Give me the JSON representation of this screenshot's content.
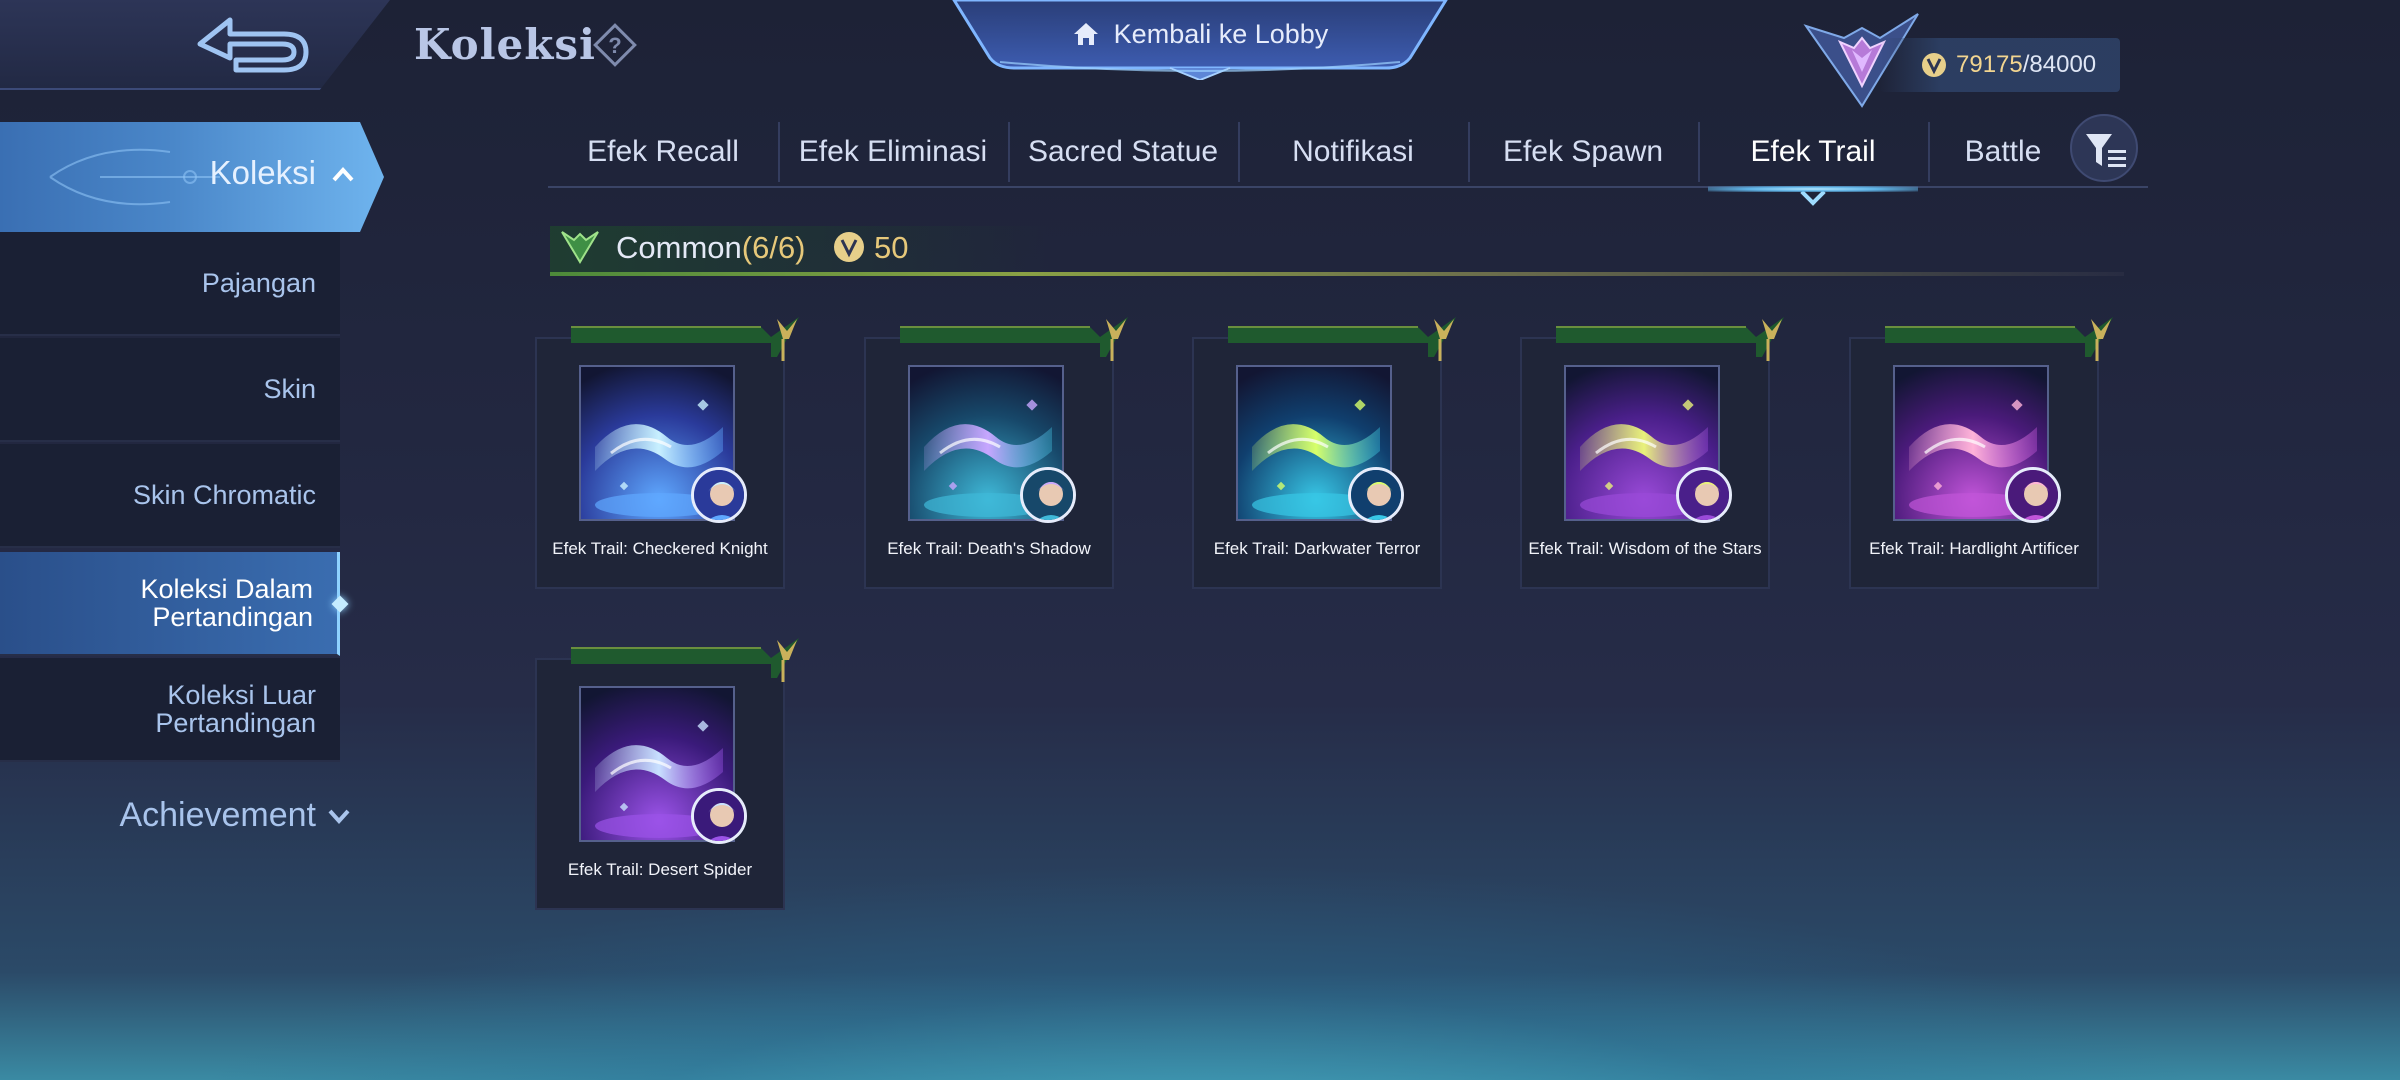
{
  "header": {
    "title": "Koleksi",
    "lobby_label": "Kembali ke Lobby",
    "currency_current": "79175",
    "currency_total": "/84000"
  },
  "sidebar": {
    "main_label": "Koleksi",
    "items": [
      {
        "label": "Pajangan",
        "active": false
      },
      {
        "label": "Skin",
        "active": false
      },
      {
        "label": "Skin Chromatic",
        "active": false
      },
      {
        "label": "Koleksi Dalam Pertandingan",
        "active": true
      },
      {
        "label": "Koleksi Luar Pertandingan",
        "active": false
      }
    ],
    "achievement_label": "Achievement"
  },
  "tabs": [
    {
      "label": "Efek Recall",
      "active": false
    },
    {
      "label": "Efek Eliminasi",
      "active": false
    },
    {
      "label": "Sacred Statue",
      "active": false
    },
    {
      "label": "Notifikasi",
      "active": false
    },
    {
      "label": "Efek Spawn",
      "active": false
    },
    {
      "label": "Efek Trail",
      "active": true
    },
    {
      "label": "Battle",
      "active": false
    }
  ],
  "section": {
    "rarity": "Common",
    "count": "(6/6)",
    "points": "50"
  },
  "items": [
    {
      "label": "Efek Trail: Checkered Knight",
      "colors": [
        "#2a3a9a",
        "#5fa8ff",
        "#c8f0ff"
      ]
    },
    {
      "label": "Efek Trail: Death's Shadow",
      "colors": [
        "#17486a",
        "#3fb9d8",
        "#c7a6ff"
      ]
    },
    {
      "label": "Efek Trail: Darkwater Terror",
      "colors": [
        "#103f6e",
        "#38c7e6",
        "#d7ff6a"
      ]
    },
    {
      "label": "Efek Trail: Wisdom of the Stars",
      "colors": [
        "#4a1f8a",
        "#9a4ad8",
        "#e9f27a"
      ]
    },
    {
      "label": "Efek Trail: Hardlight Artificer",
      "colors": [
        "#4a1a7a",
        "#c255d9",
        "#ffb3d9"
      ]
    },
    {
      "label": "Efek Trail: Desert Spider",
      "colors": [
        "#3a1a7a",
        "#9b53e8",
        "#c8e0ff"
      ]
    }
  ],
  "colors": {
    "accent_blue": "#6fb4ee",
    "gold": "#e6c87a",
    "rarity_green": "#4d8a3a"
  }
}
